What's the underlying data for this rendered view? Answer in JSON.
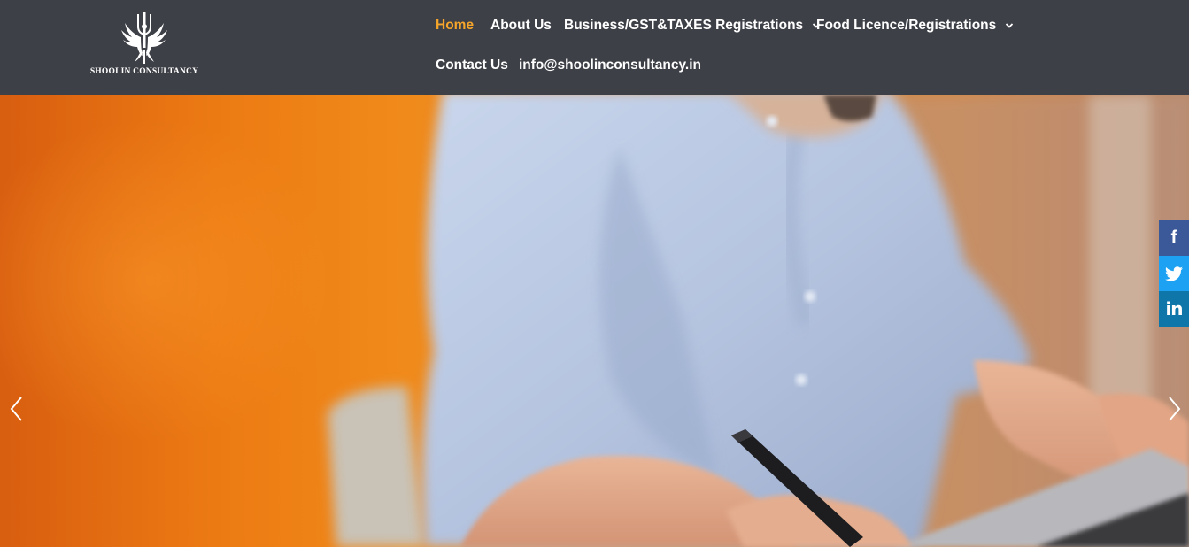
{
  "brand": {
    "name": "SHOOLIN CONSULTANCY",
    "logo_icon": "trident-phoenix-icon"
  },
  "nav": {
    "items": [
      {
        "label": "Home",
        "active": true
      },
      {
        "label": "About Us"
      },
      {
        "label": "Business/GST&TAXES Registrations",
        "dropdown": true
      },
      {
        "label": "Food Licence/Registrations",
        "dropdown": true
      },
      {
        "label": "Contact Us"
      },
      {
        "label": "info@shoolinconsultancy.in"
      }
    ]
  },
  "slider": {
    "prev_icon": "chevron-left-icon",
    "next_icon": "chevron-right-icon"
  },
  "social": {
    "facebook_glyph": "f",
    "twitter_icon": "twitter-icon",
    "linkedin_glyph": "in"
  },
  "colors": {
    "header_bg": "#3e4047",
    "accent": "#f5a52a",
    "facebook": "#3b5998",
    "twitter": "#1da1f2",
    "linkedin": "#0e76a8"
  }
}
